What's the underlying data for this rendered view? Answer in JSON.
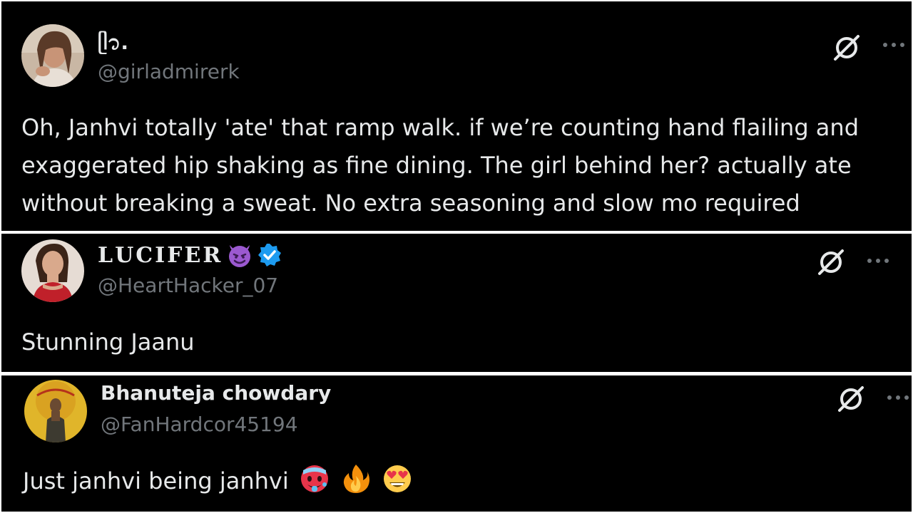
{
  "tweets": [
    {
      "display_name": "ᥫ᭡.",
      "handle": "@girladmirerk",
      "text": "Oh, Janhvi totally 'ate' that ramp walk. if we’re counting hand flailing and exaggerated hip shaking as fine dining. The girl behind her? actually ate without breaking a sweat. No extra seasoning and slow mo required",
      "icons": [
        "grok-icon",
        "more-icon"
      ]
    },
    {
      "display_name": "𝐋𝐔𝐂𝐈𝐅𝐄𝐑",
      "name_icons": [
        "smiling-devil-emoji",
        "verified-badge-icon"
      ],
      "handle": "@HeartHacker_07",
      "text": "Stunning Jaanu",
      "icons": [
        "grok-icon",
        "more-icon"
      ]
    },
    {
      "display_name": "Bhanuteja chowdary",
      "handle": "@FanHardcor45194",
      "text": "Just janhvi being janhvi",
      "text_emojis": [
        "hot-face-emoji",
        "fire-emoji",
        "heart-eyes-emoji"
      ],
      "icons": [
        "grok-icon",
        "more-icon"
      ]
    }
  ],
  "colors": {
    "background": "#000000",
    "text": "#e7e9ea",
    "secondary": "#71767b",
    "verified": "#1d9bf0",
    "devil": "#9b59d0"
  }
}
